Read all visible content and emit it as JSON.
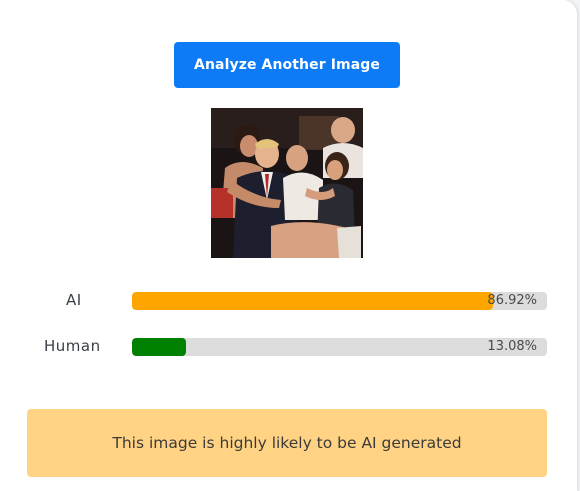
{
  "actions": {
    "analyze_label": "Analyze Another Image"
  },
  "image": {
    "alt": "Uploaded photo being analyzed"
  },
  "results": [
    {
      "label": "AI",
      "percent_text": "86.92%",
      "value": 86.92,
      "color": "#ffa500"
    },
    {
      "label": "Human",
      "percent_text": "13.08%",
      "value": 13.08,
      "color": "#008000"
    }
  ],
  "verdict": {
    "text": "This image is highly likely to be AI generated",
    "background": "#ffd383"
  },
  "colors": {
    "button": "#0d7bf5",
    "track": "#dcdcdc"
  }
}
